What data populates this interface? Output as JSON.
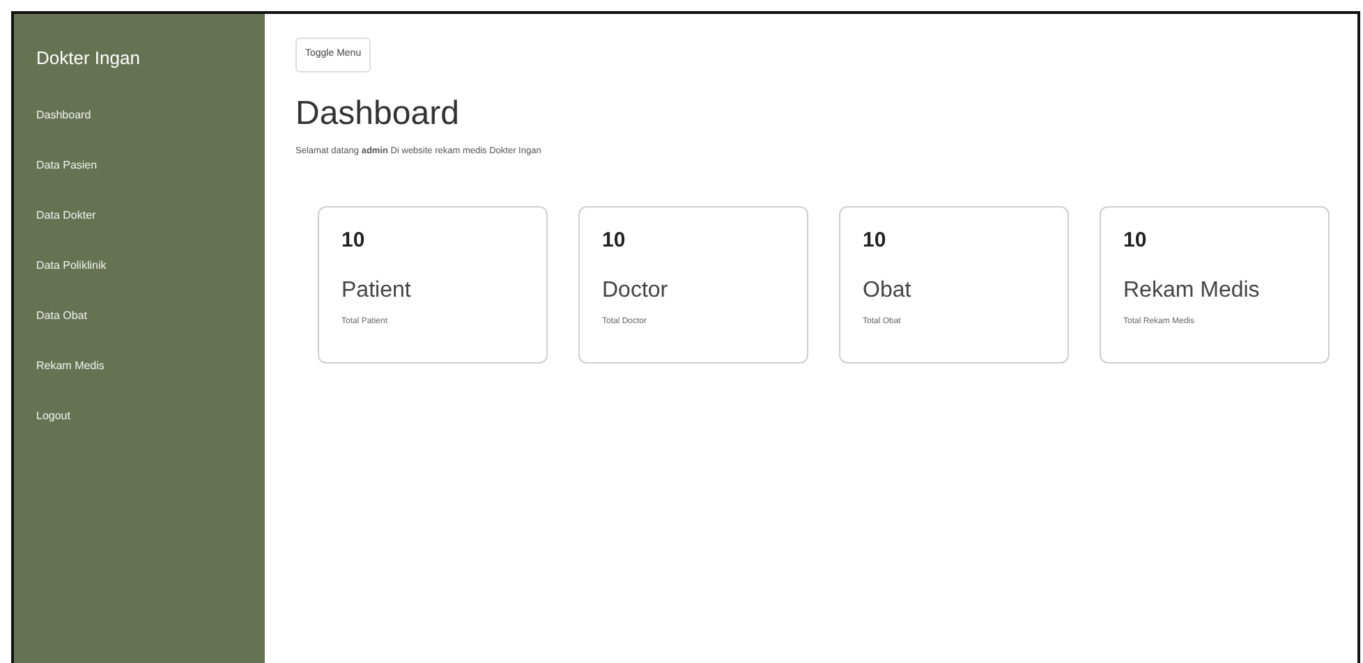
{
  "sidebar": {
    "title": "Dokter Ingan",
    "items": [
      {
        "label": "Dashboard"
      },
      {
        "label": "Data Pasien"
      },
      {
        "label": "Data Dokter"
      },
      {
        "label": "Data Poliklinik"
      },
      {
        "label": "Data Obat"
      },
      {
        "label": "Rekam Medis"
      },
      {
        "label": "Logout"
      }
    ]
  },
  "toggle_button": "Toggle Menu",
  "heading": "Dashboard",
  "welcome": "Selamat datang **admin** Di website rekam medis Dokter Ingan",
  "cards": [
    {
      "count": "10",
      "title": "Patient",
      "subtitle": "Total Patient"
    },
    {
      "count": "10",
      "title": "Doctor",
      "subtitle": "Total Doctor"
    },
    {
      "count": "10",
      "title": "Obat",
      "subtitle": "Total Obat"
    },
    {
      "count": "10",
      "title": "Rekam Medis",
      "subtitle": "Total Rekam Medis"
    }
  ]
}
